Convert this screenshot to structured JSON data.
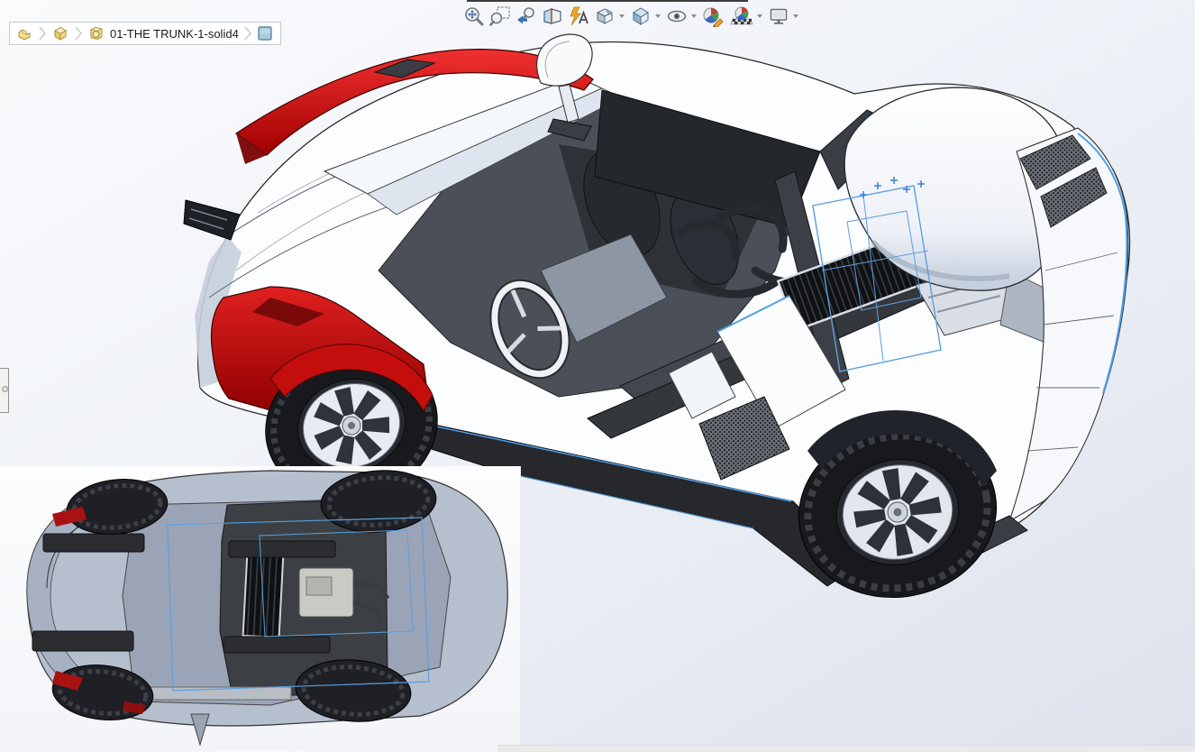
{
  "breadcrumb": {
    "items": [
      {
        "name": "document-part",
        "icon": "part-icon",
        "label": ""
      },
      {
        "name": "solid-bodies-folder",
        "icon": "solid-bodies-icon",
        "label": ""
      },
      {
        "name": "solid-body",
        "icon": "solid-body-icon",
        "label": "01-THE TRUNK-1-solid4"
      },
      {
        "name": "appearance",
        "icon": "appearance-swatch-icon",
        "label": ""
      }
    ]
  },
  "toolbar": {
    "name": "heads-up-view-toolbar",
    "buttons": [
      {
        "name": "zoom-to-fit",
        "icon": "zoom-to-fit-icon",
        "dropdown": false
      },
      {
        "name": "zoom-to-area",
        "icon": "zoom-to-area-icon",
        "dropdown": false
      },
      {
        "name": "previous-view",
        "icon": "previous-view-icon",
        "dropdown": false
      },
      {
        "name": "section-view",
        "icon": "section-view-icon",
        "dropdown": false
      },
      {
        "name": "dynamic-annotation-views",
        "icon": "annotation-views-icon",
        "dropdown": false
      },
      {
        "name": "view-orientation",
        "icon": "view-orientation-icon",
        "dropdown": true
      },
      {
        "name": "display-style",
        "icon": "display-style-icon",
        "dropdown": true
      },
      {
        "name": "hide-show-items",
        "icon": "eye-icon",
        "dropdown": true
      },
      {
        "name": "edit-appearance",
        "icon": "edit-appearance-icon",
        "dropdown": false
      },
      {
        "name": "apply-scene",
        "icon": "apply-scene-icon",
        "dropdown": true
      },
      {
        "name": "view-settings",
        "icon": "monitor-icon",
        "dropdown": true
      }
    ]
  },
  "viewport": {
    "main_view": {
      "content": "isometric shaded-with-edges view of a supercar assembly, body panels transparent showing chassis, seats, steering wheel and engine",
      "accent_color": "#c81111",
      "wireframe_highlight_color": "#5b9fe0"
    },
    "inset_view": {
      "content": "bottom view of the same supercar assembly"
    }
  },
  "colors": {
    "background_top": "#fafbfd",
    "background_bottom": "#dde2ec",
    "menu_divider": "#3c3c3c",
    "breadcrumb_border": "#c9c9c9"
  }
}
